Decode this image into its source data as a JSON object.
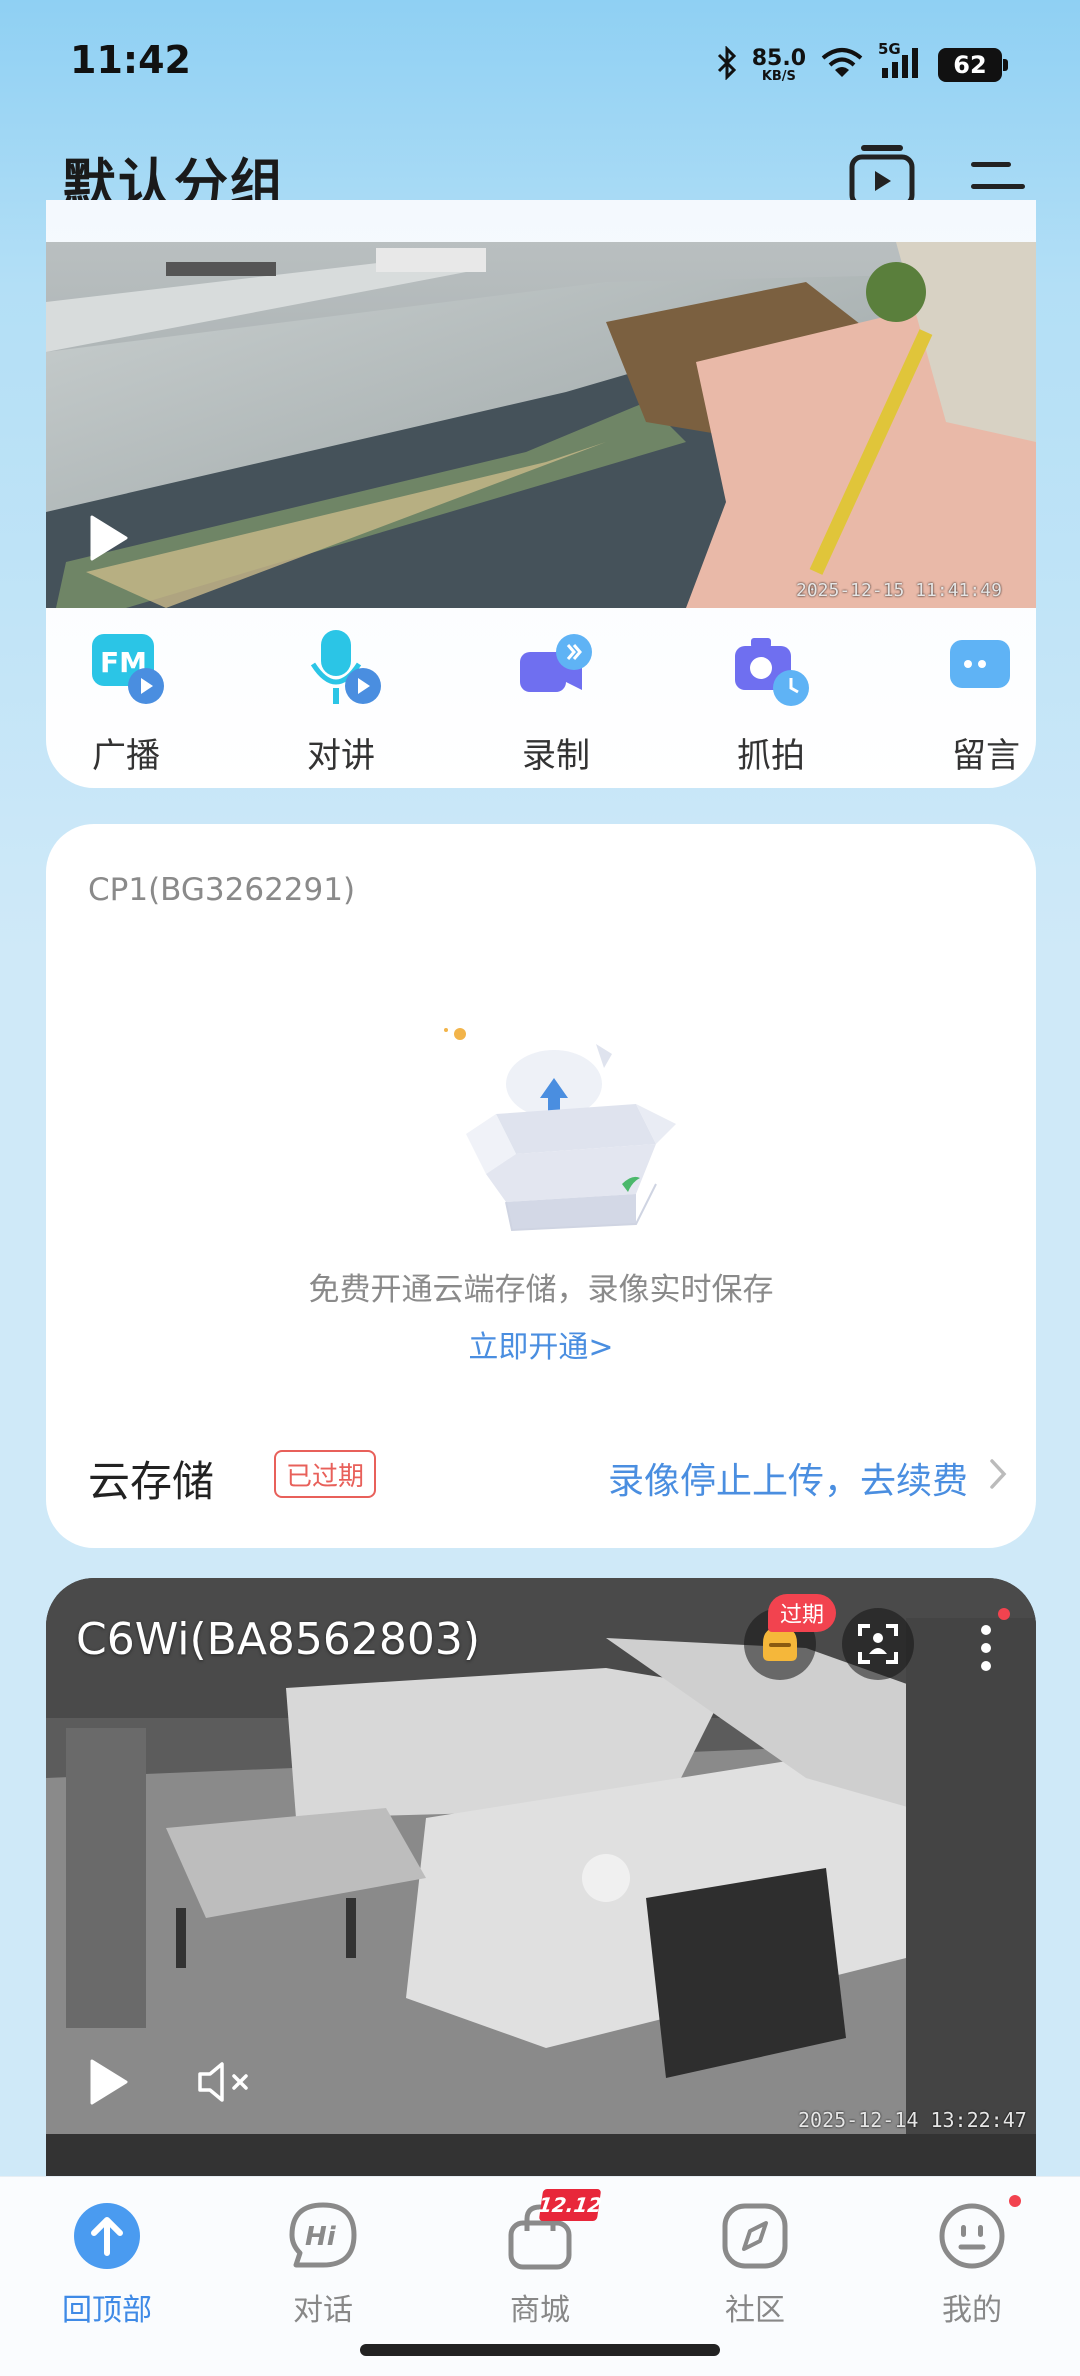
{
  "status_bar": {
    "time": "11:42",
    "net_speed_value": "85.0",
    "net_speed_unit": "KB/S",
    "network": "5G",
    "battery": "62"
  },
  "header": {
    "title": "默认分组"
  },
  "camera1": {
    "timestamp": "2025-12-15 11:41:49",
    "actions": [
      {
        "label": "广播",
        "icon": "fm-broadcast-icon"
      },
      {
        "label": "对讲",
        "icon": "intercom-icon"
      },
      {
        "label": "录制",
        "icon": "record-icon"
      },
      {
        "label": "抓拍",
        "icon": "snapshot-icon"
      },
      {
        "label": "留言",
        "icon": "message-icon"
      }
    ]
  },
  "cloud_card": {
    "device_name": "CP1(BG3262291)",
    "promo_text": "免费开通云端存储，录像实时保存",
    "promo_link": "立即开通>",
    "cloud_title": "云存储",
    "expired_badge": "已过期",
    "renew_link": "录像停止上传，去续费"
  },
  "camera2": {
    "title": "C6Wi(BA8562803)",
    "expired_tag": "过期",
    "timestamp": "2025-12-14 13:22:47"
  },
  "bottom_nav": {
    "items": [
      {
        "label": "回顶部",
        "icon": "back-to-top-icon"
      },
      {
        "label": "对话",
        "icon": "chat-icon"
      },
      {
        "label": "商城",
        "icon": "shop-icon",
        "badge": "12.12"
      },
      {
        "label": "社区",
        "icon": "community-icon"
      },
      {
        "label": "我的",
        "icon": "profile-icon"
      }
    ]
  },
  "colors": {
    "accent": "#3f8ae6",
    "link": "#4a8ee0",
    "alert": "#e8605a",
    "badge": "#f2434f"
  }
}
